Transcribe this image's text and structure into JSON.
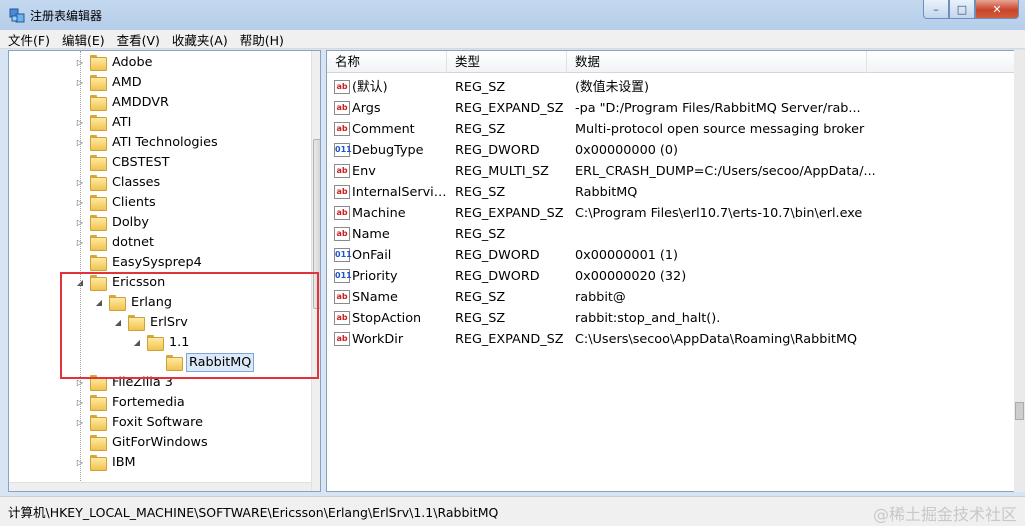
{
  "window": {
    "title": "注册表编辑器",
    "min": "–",
    "max": "□",
    "close": "✕"
  },
  "menu": [
    "文件(F)",
    "编辑(E)",
    "查看(V)",
    "收藏夹(A)",
    "帮助(H)"
  ],
  "tree": [
    {
      "label": "Adobe",
      "depth": 0,
      "expander": "▷"
    },
    {
      "label": "AMD",
      "depth": 0,
      "expander": "▷"
    },
    {
      "label": "AMDDVR",
      "depth": 0,
      "expander": ""
    },
    {
      "label": "ATI",
      "depth": 0,
      "expander": "▷"
    },
    {
      "label": "ATI Technologies",
      "depth": 0,
      "expander": "▷"
    },
    {
      "label": "CBSTEST",
      "depth": 0,
      "expander": ""
    },
    {
      "label": "Classes",
      "depth": 0,
      "expander": "▷"
    },
    {
      "label": "Clients",
      "depth": 0,
      "expander": "▷"
    },
    {
      "label": "Dolby",
      "depth": 0,
      "expander": "▷"
    },
    {
      "label": "dotnet",
      "depth": 0,
      "expander": "▷"
    },
    {
      "label": "EasySysprep4",
      "depth": 0,
      "expander": ""
    },
    {
      "label": "Ericsson",
      "depth": 0,
      "expander": "◢"
    },
    {
      "label": "Erlang",
      "depth": 1,
      "expander": "◢"
    },
    {
      "label": "ErlSrv",
      "depth": 2,
      "expander": "◢"
    },
    {
      "label": "1.1",
      "depth": 3,
      "expander": "◢"
    },
    {
      "label": "RabbitMQ",
      "depth": 4,
      "expander": "",
      "selected": true
    },
    {
      "label": "FileZilla 3",
      "depth": 0,
      "expander": "▷"
    },
    {
      "label": "Fortemedia",
      "depth": 0,
      "expander": "▷"
    },
    {
      "label": "Foxit Software",
      "depth": 0,
      "expander": "▷"
    },
    {
      "label": "GitForWindows",
      "depth": 0,
      "expander": ""
    },
    {
      "label": "IBM",
      "depth": 0,
      "expander": "▷"
    }
  ],
  "list": {
    "headers": [
      "名称",
      "类型",
      "数据"
    ],
    "rows": [
      {
        "icon": "ab",
        "kind": "sz",
        "name": "(默认)",
        "type": "REG_SZ",
        "data": "(数值未设置)"
      },
      {
        "icon": "ab",
        "kind": "sz",
        "name": "Args",
        "type": "REG_EXPAND_SZ",
        "data": " -pa \"D:/Program Files/RabbitMQ Server/rab..."
      },
      {
        "icon": "ab",
        "kind": "sz",
        "name": "Comment",
        "type": "REG_SZ",
        "data": "Multi-protocol open source messaging broker"
      },
      {
        "icon": "011",
        "kind": "bin",
        "name": "DebugType",
        "type": "REG_DWORD",
        "data": "0x00000000 (0)"
      },
      {
        "icon": "ab",
        "kind": "sz",
        "name": "Env",
        "type": "REG_MULTI_SZ",
        "data": "ERL_CRASH_DUMP=C:/Users/secoo/AppData/..."
      },
      {
        "icon": "ab",
        "kind": "sz",
        "name": "InternalService...",
        "type": "REG_SZ",
        "data": "RabbitMQ"
      },
      {
        "icon": "ab",
        "kind": "sz",
        "name": "Machine",
        "type": "REG_EXPAND_SZ",
        "data": "C:\\Program Files\\erl10.7\\erts-10.7\\bin\\erl.exe"
      },
      {
        "icon": "ab",
        "kind": "sz",
        "name": "Name",
        "type": "REG_SZ",
        "data": ""
      },
      {
        "icon": "011",
        "kind": "bin",
        "name": "OnFail",
        "type": "REG_DWORD",
        "data": "0x00000001 (1)"
      },
      {
        "icon": "011",
        "kind": "bin",
        "name": "Priority",
        "type": "REG_DWORD",
        "data": "0x00000020 (32)"
      },
      {
        "icon": "ab",
        "kind": "sz",
        "name": "SName",
        "type": "REG_SZ",
        "data": "rabbit@"
      },
      {
        "icon": "ab",
        "kind": "sz",
        "name": "StopAction",
        "type": "REG_SZ",
        "data": "rabbit:stop_and_halt()."
      },
      {
        "icon": "ab",
        "kind": "sz",
        "name": "WorkDir",
        "type": "REG_EXPAND_SZ",
        "data": "C:\\Users\\secoo\\AppData\\Roaming\\RabbitMQ"
      }
    ]
  },
  "status": {
    "path": "计算机\\HKEY_LOCAL_MACHINE\\SOFTWARE\\Ericsson\\Erlang\\ErlSrv\\1.1\\RabbitMQ",
    "watermark": "@稀土掘金技术社区"
  }
}
